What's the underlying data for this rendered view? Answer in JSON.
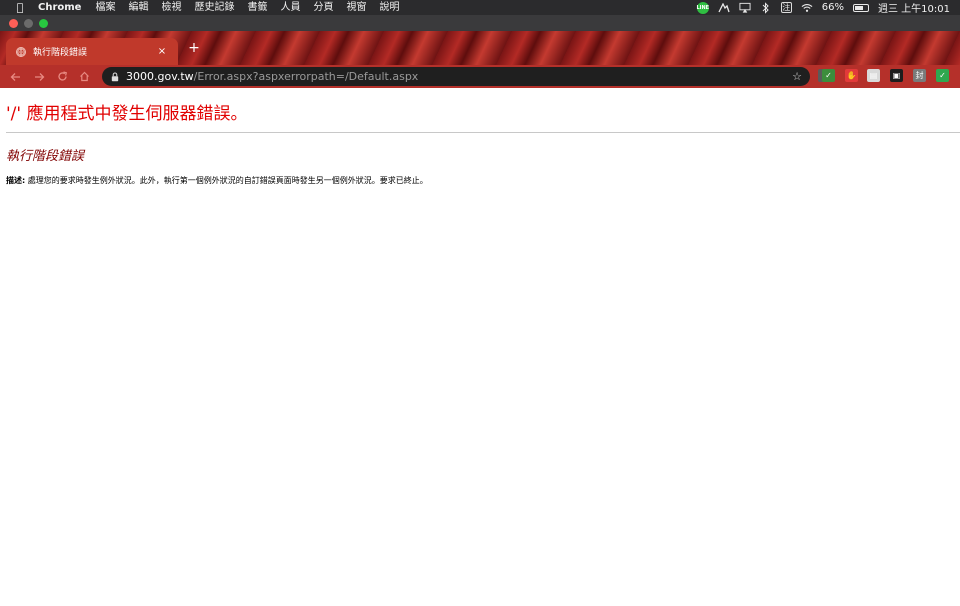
{
  "menubar": {
    "app": "Chrome",
    "items": [
      "檔案",
      "編輯",
      "檢視",
      "歷史記錄",
      "書籤",
      "人員",
      "分頁",
      "視窗",
      "說明"
    ],
    "line_label": "LINE",
    "ime_label": "注",
    "battery_percent": "66%",
    "battery_level": 0.66,
    "clock": "週三 上午10:01"
  },
  "tab": {
    "title": "執行階段錯誤",
    "close_label": "×",
    "new_tab_label": "+"
  },
  "address_bar": {
    "host": "3000.gov.tw",
    "path": "/Error.aspx?aspxerrorpath=/Default.aspx"
  },
  "extensions": [
    {
      "name": "ext-1",
      "color": "#5a5a5a",
      "label": ""
    },
    {
      "name": "ext-2",
      "color": "#3c8d3c",
      "label": "✓"
    },
    {
      "name": "ext-3",
      "color": "#e23a3a",
      "label": "✋"
    },
    {
      "name": "ext-4",
      "color": "#d9d9d9",
      "label": "▤"
    },
    {
      "name": "ext-5",
      "color": "#1d1d1d",
      "label": "▣"
    },
    {
      "name": "ext-6",
      "color": "#7a7a7a",
      "label": "封"
    },
    {
      "name": "ext-7",
      "color": "#2fa84f",
      "label": "✓"
    }
  ],
  "page": {
    "title": "'/' 應用程式中發生伺服器錯誤。",
    "subtitle": "執行階段錯誤",
    "desc_label": "描述:",
    "desc_text": " 處理您的要求時發生例外狀況。此外，執行第一個例外狀況的自訂錯誤頁面時發生另一個例外狀況。要求已終止。"
  },
  "colors": {
    "title_red": "#e10000",
    "subtitle_maroon": "#800000",
    "tab_red": "#c0392b",
    "toolbar_red": "#b5302a"
  }
}
